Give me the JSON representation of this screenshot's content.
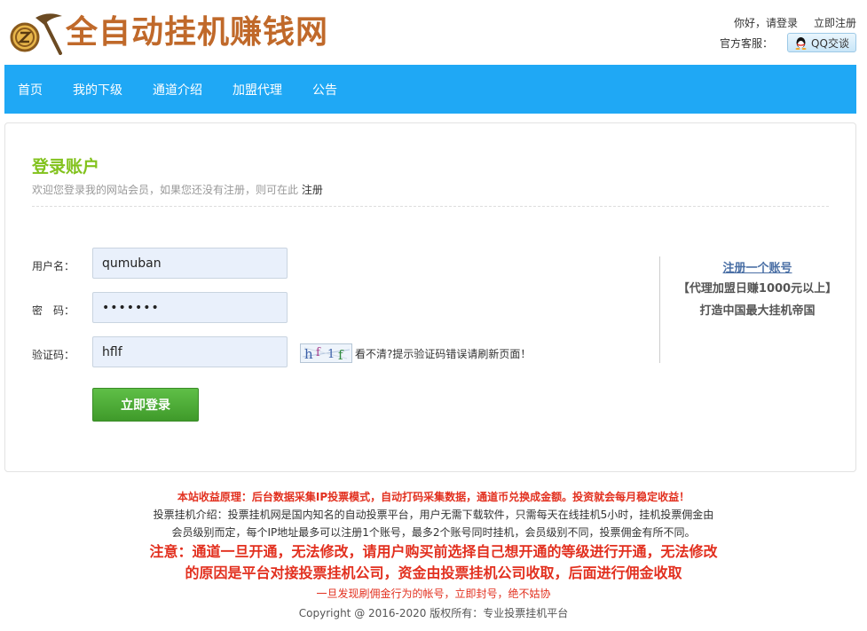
{
  "header": {
    "logo_text": "全自动挂机赚钱网",
    "greeting": "你好，请登录",
    "register_link": "立即注册",
    "service_label": "官方客服：",
    "qq_button": "QQ交谈"
  },
  "nav": {
    "items": [
      "首页",
      "我的下级",
      "通道介绍",
      "加盟代理",
      "公告"
    ]
  },
  "login": {
    "title": "登录账户",
    "subtitle": "欢迎您登录我的网站会员，如果您还没有注册，则可在此",
    "subtitle_link": "注册",
    "username_label": "用户名：",
    "username_value": "qumuban",
    "password_label": "密　码：",
    "password_value": "•••••••",
    "captcha_label": "验证码：",
    "captcha_value": "hflf",
    "captcha_image_text": "hf1f",
    "captcha_hint": "看不清?提示验证码错误请刷新页面！",
    "login_button": "立即登录"
  },
  "side": {
    "register_link": "注册一个账号",
    "line1": "【代理加盟日赚1000元以上】",
    "line2": "打造中国最大挂机帝国"
  },
  "footer": {
    "line1": "本站收益原理：后台数据采集IP投票模式，自动打码采集数据，通道币兑换成金额。投资就会每月稳定收益！",
    "line2": "投票挂机介绍：投票挂机网是国内知名的自动投票平台，用户无需下载软件，只需每天在线挂机5小时，挂机投票佣金由",
    "line3": "会员级别而定，每个IP地址最多可以注册1个账号，最多2个账号同时挂机，会员级别不同，投票佣金有所不同。",
    "line4": "注意：通道一旦开通，无法修改，请用户购买前选择自己想开通的等级进行开通，无法修改",
    "line5": "的原因是平台对接投票挂机公司，资金由投票挂机公司收取，后面进行佣金收取",
    "line6": "一旦发现刷佣金行为的帐号，立即封号，绝不姑协",
    "copyright": "Copyright @ 2016-2020   版权所有：专业投票挂机平台"
  },
  "colors": {
    "nav_bg": "#1fa8f5",
    "title_green": "#82c21d",
    "button_green": "#4aa833",
    "logo_brown": "#c0692a",
    "footer_red": "#e2301f"
  }
}
